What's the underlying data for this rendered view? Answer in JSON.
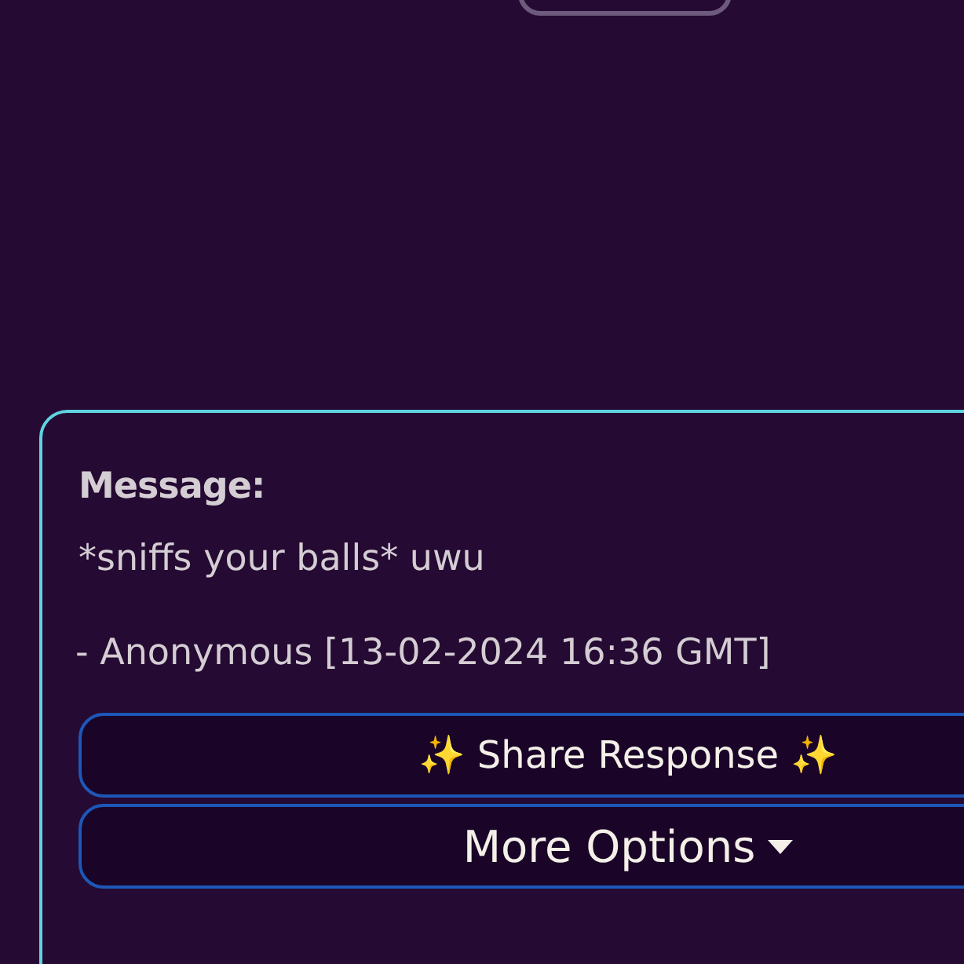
{
  "top_button": {
    "kind": "outline"
  },
  "card": {
    "heading": "Message:",
    "message": "*sniffs your balls* uwu",
    "signature": "- Anonymous [13-02-2024 16:36 GMT]",
    "buttons": [
      {
        "label": "✨ Share Response ✨",
        "kind": "plain"
      },
      {
        "label": "More Options",
        "kind": "dropdown"
      }
    ]
  }
}
